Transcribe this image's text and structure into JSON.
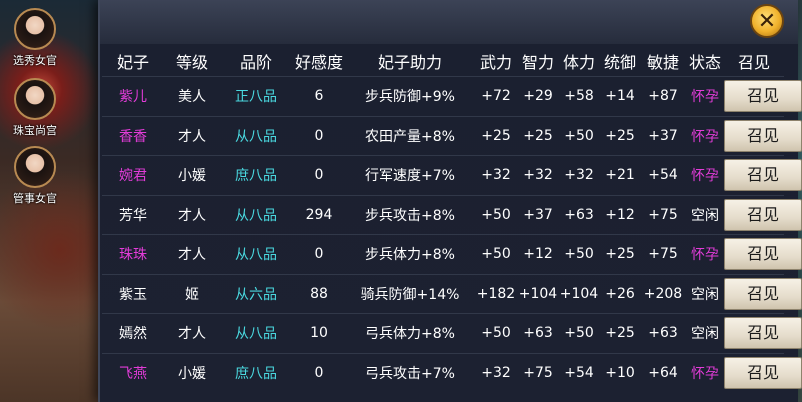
{
  "sidebar": [
    {
      "label": "选秀女官"
    },
    {
      "label": "珠宝尚宫"
    },
    {
      "label": "管事女官"
    }
  ],
  "headers": [
    "妃子",
    "等级",
    "品阶",
    "好感度",
    "妃子助力",
    "武力",
    "智力",
    "体力",
    "统御",
    "敏捷",
    "状态",
    "召见"
  ],
  "colors": {
    "pink": "#e23cd8",
    "cyan": "#4ad9e0",
    "white": "#ffffff"
  },
  "close_icon": "close-icon",
  "rows": [
    {
      "name": "紫儿",
      "name_color": "pink",
      "rank": "美人",
      "grade": "正八品",
      "favor": "6",
      "bonus": "步兵防御+9%",
      "force": "+72",
      "intel": "+29",
      "stamina": "+58",
      "command": "+14",
      "agility": "+87",
      "status": "怀孕",
      "status_color": "pink",
      "button": "召见"
    },
    {
      "name": "香香",
      "name_color": "pink",
      "rank": "才人",
      "grade": "从八品",
      "favor": "0",
      "bonus": "农田产量+8%",
      "force": "+25",
      "intel": "+25",
      "stamina": "+50",
      "command": "+25",
      "agility": "+37",
      "status": "怀孕",
      "status_color": "pink",
      "button": "召见"
    },
    {
      "name": "婉君",
      "name_color": "pink",
      "rank": "小媛",
      "grade": "庶八品",
      "favor": "0",
      "bonus": "行军速度+7%",
      "force": "+32",
      "intel": "+32",
      "stamina": "+32",
      "command": "+21",
      "agility": "+54",
      "status": "怀孕",
      "status_color": "pink",
      "button": "召见"
    },
    {
      "name": "芳华",
      "name_color": "white",
      "rank": "才人",
      "grade": "从八品",
      "favor": "294",
      "bonus": "步兵攻击+8%",
      "force": "+50",
      "intel": "+37",
      "stamina": "+63",
      "command": "+12",
      "agility": "+75",
      "status": "空闲",
      "status_color": "white",
      "button": "召见"
    },
    {
      "name": "珠珠",
      "name_color": "pink",
      "rank": "才人",
      "grade": "从八品",
      "favor": "0",
      "bonus": "步兵体力+8%",
      "force": "+50",
      "intel": "+12",
      "stamina": "+50",
      "command": "+25",
      "agility": "+75",
      "status": "怀孕",
      "status_color": "pink",
      "button": "召见"
    },
    {
      "name": "紫玉",
      "name_color": "white",
      "rank": "姬",
      "grade": "从六品",
      "favor": "88",
      "bonus": "骑兵防御+14%",
      "force": "+182",
      "intel": "+104",
      "stamina": "+104",
      "command": "+26",
      "agility": "+208",
      "status": "空闲",
      "status_color": "white",
      "button": "召见"
    },
    {
      "name": "嫣然",
      "name_color": "white",
      "rank": "才人",
      "grade": "从八品",
      "favor": "10",
      "bonus": "弓兵体力+8%",
      "force": "+50",
      "intel": "+63",
      "stamina": "+50",
      "command": "+25",
      "agility": "+63",
      "status": "空闲",
      "status_color": "white",
      "button": "召见"
    },
    {
      "name": "飞燕",
      "name_color": "pink",
      "rank": "小媛",
      "grade": "庶八品",
      "favor": "0",
      "bonus": "弓兵攻击+7%",
      "force": "+32",
      "intel": "+75",
      "stamina": "+54",
      "command": "+10",
      "agility": "+64",
      "status": "怀孕",
      "status_color": "pink",
      "button": "召见"
    }
  ]
}
